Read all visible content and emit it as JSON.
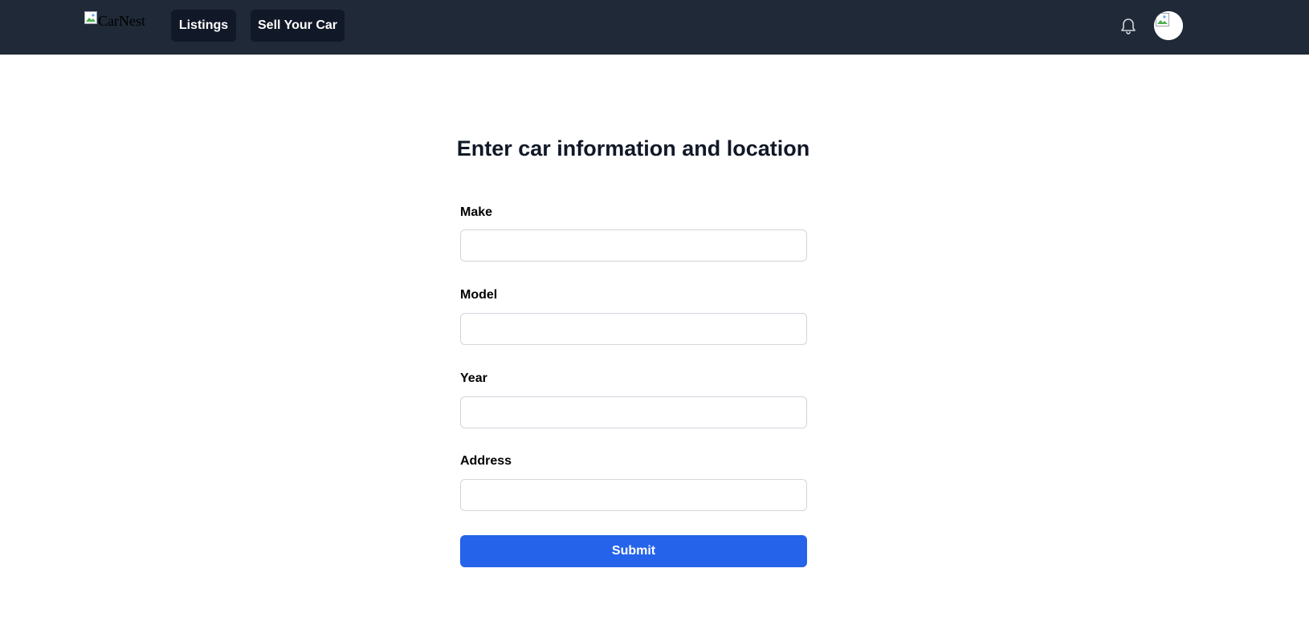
{
  "navbar": {
    "logo_alt": "CarNest",
    "items": [
      {
        "label": "Listings"
      },
      {
        "label": "Sell Your Car"
      }
    ],
    "bg_color": "#1f2937",
    "button_color": "#111827"
  },
  "form": {
    "title": "Enter car information and location",
    "fields": [
      {
        "label": "Make",
        "value": ""
      },
      {
        "label": "Model",
        "value": ""
      },
      {
        "label": "Year",
        "value": ""
      },
      {
        "label": "Address",
        "value": ""
      }
    ],
    "submit_label": "Submit",
    "submit_color": "#2563eb"
  },
  "icons": {
    "notifications": "bell-icon",
    "avatar": "user-avatar"
  }
}
